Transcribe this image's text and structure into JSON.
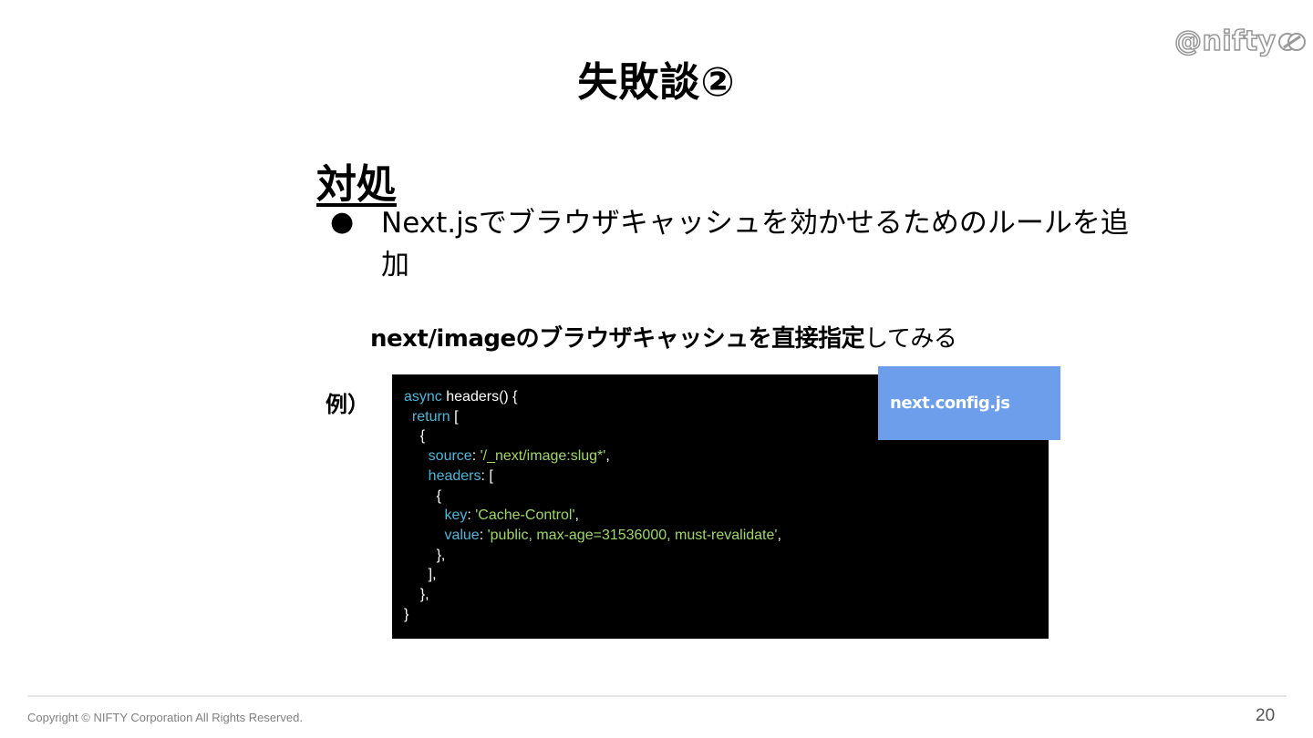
{
  "logo": {
    "text": "@nifty"
  },
  "slide": {
    "title": "失敗談②",
    "heading": "対処",
    "bullet_marker": "●",
    "bullet_text": "Next.jsでブラウザキャッシュを効かせるためのルールを追加",
    "subline_bold": "next/imageのブラウザキャッシュを直接指定",
    "subline_rest": "してみる",
    "example_label": "例）",
    "file_label": "next.config.js"
  },
  "code_lines": [
    [
      {
        "t": "async",
        "c": "kw"
      },
      {
        "t": " headers() {",
        "c": ""
      }
    ],
    [
      {
        "t": "  ",
        "c": ""
      },
      {
        "t": "return",
        "c": "kw"
      },
      {
        "t": " [",
        "c": ""
      }
    ],
    [
      {
        "t": "    {",
        "c": ""
      }
    ],
    [
      {
        "t": "      ",
        "c": ""
      },
      {
        "t": "source",
        "c": "kw"
      },
      {
        "t": ": ",
        "c": ""
      },
      {
        "t": "'/_next/image:slug*'",
        "c": "str"
      },
      {
        "t": ",",
        "c": ""
      }
    ],
    [
      {
        "t": "      ",
        "c": ""
      },
      {
        "t": "headers",
        "c": "kw"
      },
      {
        "t": ": [",
        "c": ""
      }
    ],
    [
      {
        "t": "        {",
        "c": ""
      }
    ],
    [
      {
        "t": "          ",
        "c": ""
      },
      {
        "t": "key",
        "c": "kw"
      },
      {
        "t": ": ",
        "c": ""
      },
      {
        "t": "'Cache-Control'",
        "c": "str"
      },
      {
        "t": ",",
        "c": ""
      }
    ],
    [
      {
        "t": "          ",
        "c": ""
      },
      {
        "t": "value",
        "c": "kw"
      },
      {
        "t": ": ",
        "c": ""
      },
      {
        "t": "'public, max-age=31536000, must-revalidate'",
        "c": "str"
      },
      {
        "t": ",",
        "c": ""
      }
    ],
    [
      {
        "t": "        },",
        "c": ""
      }
    ],
    [
      {
        "t": "      ],",
        "c": ""
      }
    ],
    [
      {
        "t": "    },",
        "c": ""
      }
    ],
    [
      {
        "t": "}",
        "c": ""
      }
    ]
  ],
  "footer": {
    "copyright": "Copyright © NIFTY Corporation All Rights Reserved.",
    "page_number": "20"
  }
}
